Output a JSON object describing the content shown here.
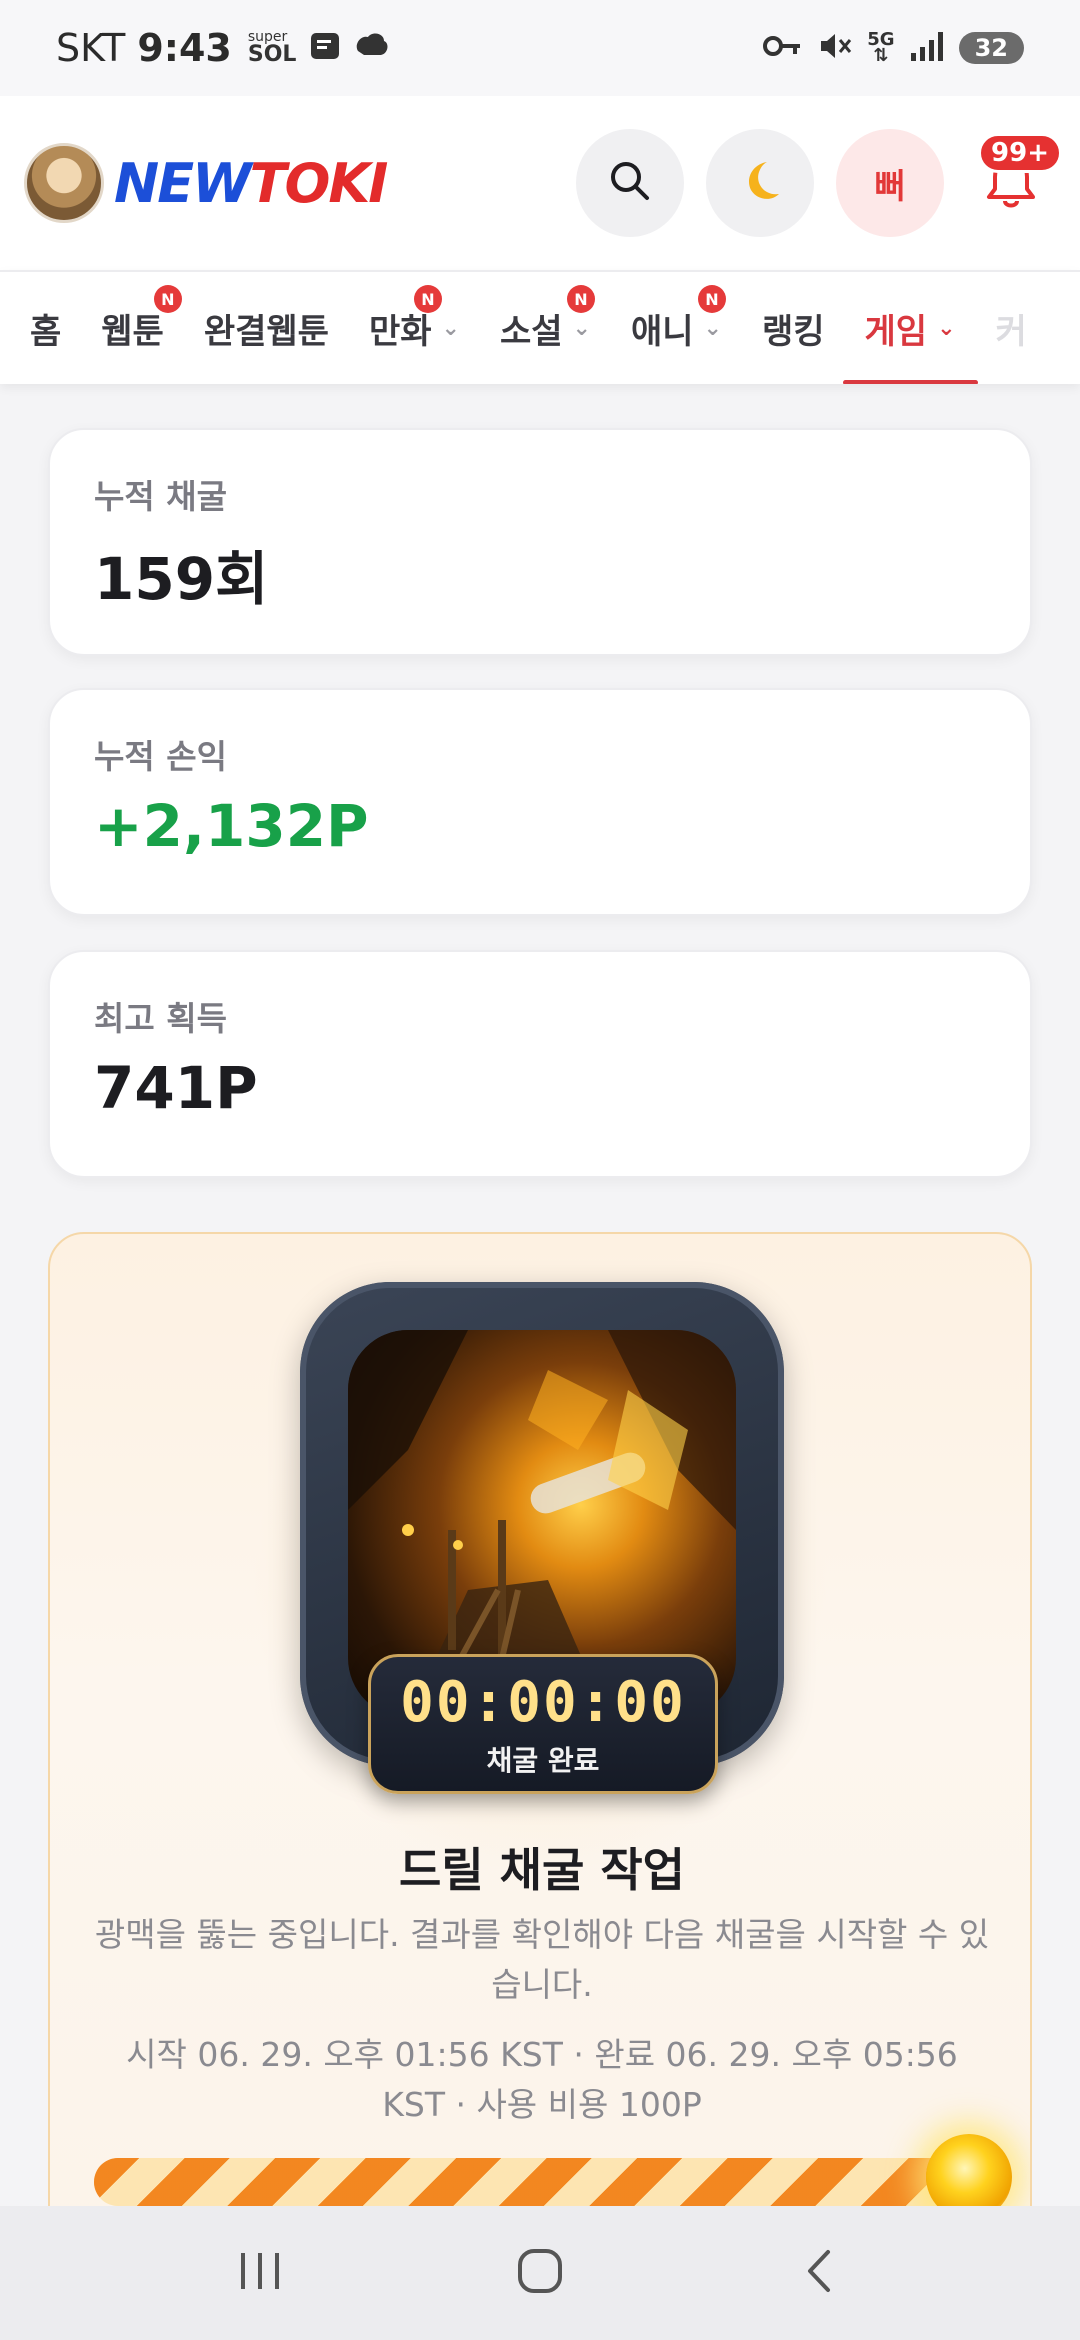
{
  "status_bar": {
    "carrier": "SKT",
    "time": "9:43",
    "super_top": "super",
    "super_bottom": "SOL",
    "network": "5G",
    "battery": "32"
  },
  "header": {
    "logo_new": "NEW",
    "logo_toki": "TOKI",
    "red_button_label": "뻐",
    "notification_badge": "99+"
  },
  "nav": {
    "tabs": [
      {
        "label": "홈"
      },
      {
        "label": "웹툰",
        "badge": "N"
      },
      {
        "label": "완결웹툰"
      },
      {
        "label": "만화",
        "badge": "N"
      },
      {
        "label": "소설",
        "badge": "N"
      },
      {
        "label": "애니",
        "badge": "N"
      },
      {
        "label": "랭킹"
      },
      {
        "label": "게임"
      },
      {
        "label": "커"
      }
    ]
  },
  "stats": [
    {
      "label": "누적 채굴",
      "value": "159회"
    },
    {
      "label": "누적 손익",
      "value": "+2,132P"
    },
    {
      "label": "최고 획득",
      "value": "741P"
    }
  ],
  "mining": {
    "timer": "00:00:00",
    "timer_status": "채굴 완료",
    "title": "드릴 채굴 작업",
    "description": "광맥을 뚫는 중입니다. 결과를 확인해야 다음 채굴을 시작할 수 있습니다.",
    "meta": "시작 06. 29. 오후 01:56 KST · 완료 06. 29. 오후 05:56 KST · 사용 비용 100P",
    "progress_fraction": 1.0
  },
  "colors": {
    "accent_red": "#d9383f",
    "profit_green": "#18a149",
    "logo_blue": "#1c4fd8",
    "timer_gold": "#ffe08a"
  }
}
